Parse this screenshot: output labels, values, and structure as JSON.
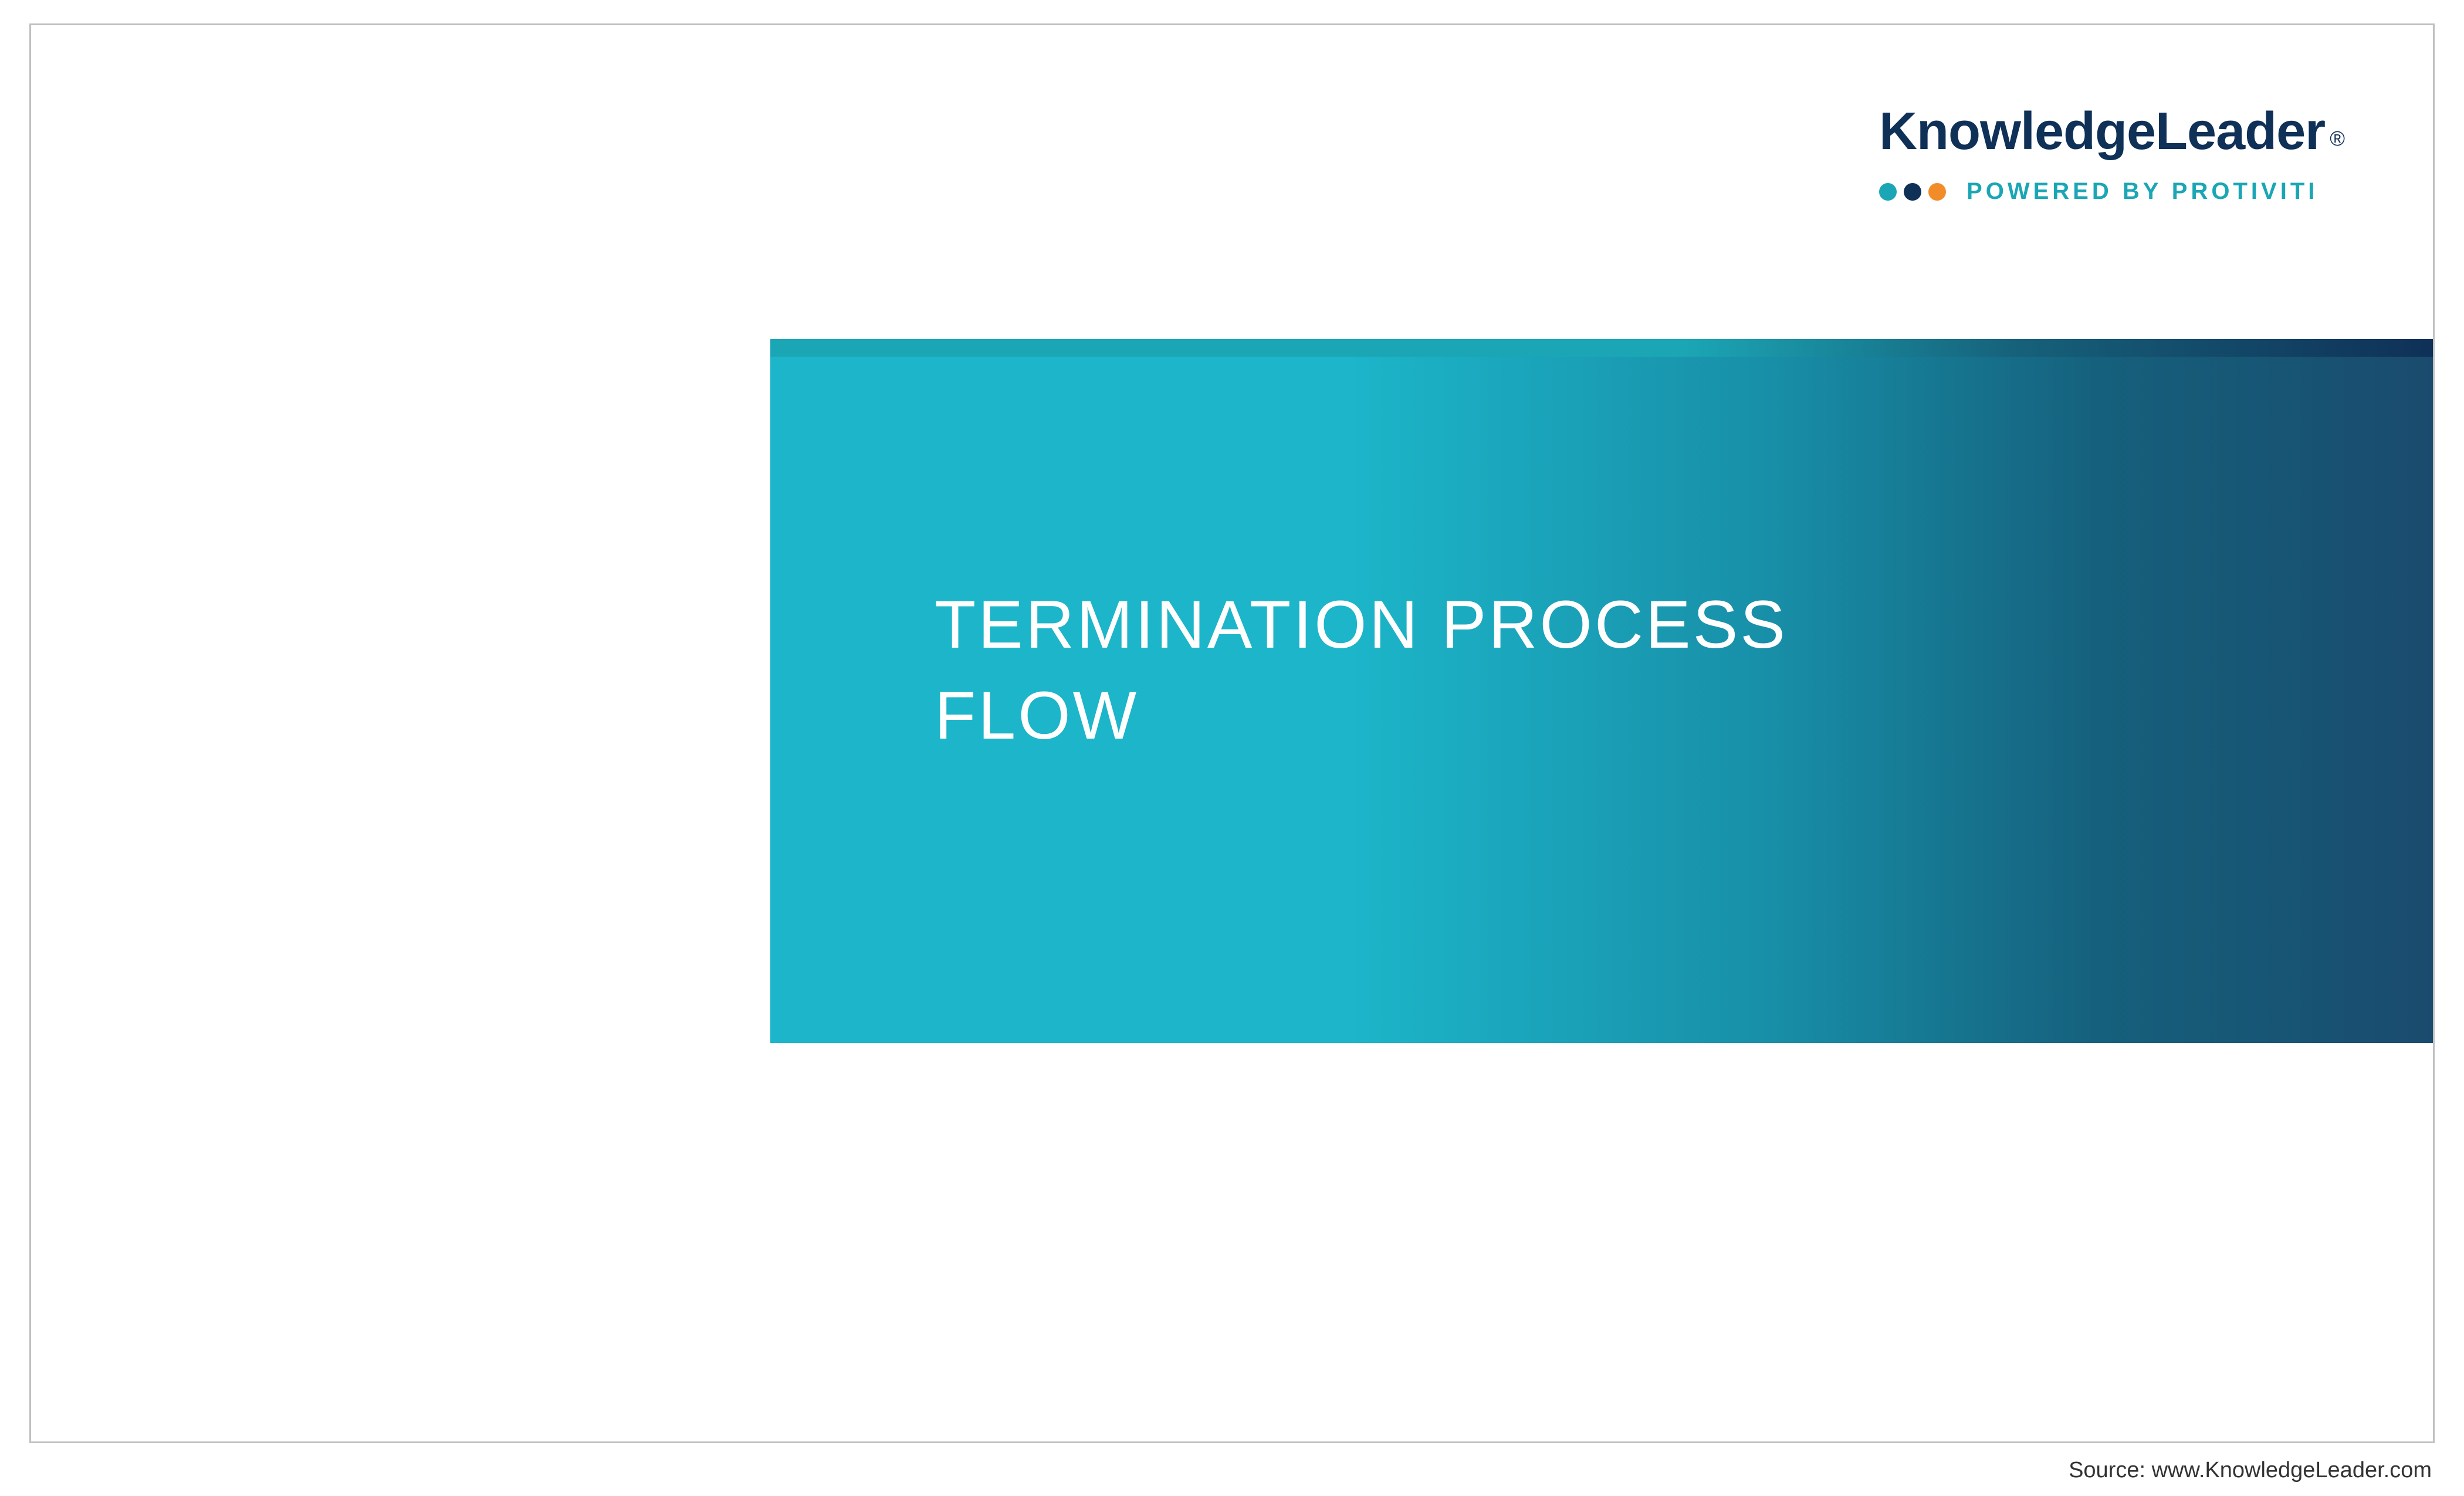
{
  "logo": {
    "brand": "KnowledgeLeader",
    "registered": "®",
    "tagline": "POWERED BY PROTIVITI"
  },
  "title": {
    "line1": "TERMINATION PROCESS",
    "line2": "FLOW"
  },
  "footer": {
    "source": "Source: www.KnowledgeLeader.com"
  }
}
